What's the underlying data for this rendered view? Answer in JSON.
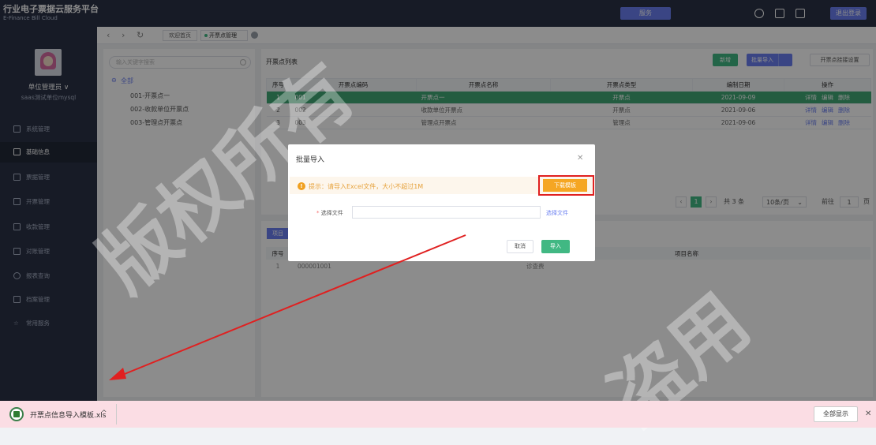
{
  "header": {
    "title": "行业电子票据云服务平台",
    "subtitle": "E-Finance Bill Cloud",
    "service_label": "服务",
    "logout_label": "退出登录"
  },
  "sidebar": {
    "role": "单位管理员 ∨",
    "org": "saas测试单位mysql",
    "items": [
      {
        "label": "系统管理"
      },
      {
        "label": "基础信息"
      },
      {
        "label": "票据管理"
      },
      {
        "label": "开票管理"
      },
      {
        "label": "收款管理"
      },
      {
        "label": "对账管理"
      },
      {
        "label": "报表查询"
      },
      {
        "label": "档案管理"
      },
      {
        "label": "常用服务"
      }
    ]
  },
  "tabs": {
    "back": "‹",
    "forward": "›",
    "refresh": "↻",
    "home": "欢迎首页",
    "current": "开票点管理"
  },
  "tree": {
    "search_placeholder": "输入关键字搜索",
    "root": "全部",
    "nodes": [
      "001-开票点一",
      "002-收款单位开票点",
      "003-管理点开票点"
    ]
  },
  "list": {
    "title": "开票点列表",
    "add_label": "新增",
    "batch_label": "批量导入",
    "settings_label": "开票点挂接设置",
    "columns": [
      "序号",
      "开票点编码",
      "开票点名称",
      "开票点类型",
      "编制日期",
      "操作"
    ],
    "rows": [
      {
        "no": "1",
        "code": "001",
        "name": "开票点一",
        "type": "开票点",
        "date": "2021-09-09"
      },
      {
        "no": "2",
        "code": "002",
        "name": "收款单位开票点",
        "type": "开票点",
        "date": "2021-09-06"
      },
      {
        "no": "3",
        "code": "003",
        "name": "管理点开票点",
        "type": "管理点",
        "date": "2021-09-06"
      }
    ],
    "actions": [
      "详情",
      "编辑",
      "删除"
    ]
  },
  "pagination": {
    "current_page": "1",
    "total": "共 3 条",
    "page_size": "10条/页",
    "goto_prefix": "前往",
    "goto_value": "1",
    "goto_suffix": "页"
  },
  "project": {
    "tab_label": "项目",
    "columns": [
      "序号",
      "项目名称"
    ],
    "rows": [
      {
        "no": "1",
        "code": "000001001",
        "name": "诊查费"
      }
    ]
  },
  "modal": {
    "title": "批量导入",
    "alert_icon": "!",
    "alert_text": "提示：请导入Excel文件，大小不超过1M",
    "download_label": "下载模板",
    "file_label_star": "*",
    "file_label": "选择文件",
    "file_select": "选择文件",
    "cancel_label": "取消",
    "import_label": "导入"
  },
  "download_bar": {
    "file_name": "开票点信息导入模板.xls",
    "chevron": "^",
    "show_all": "全部显示",
    "close": "✕"
  },
  "watermark": [
    "版权所有",
    "盗用"
  ],
  "colors": {
    "dark_nav": "#2b3246",
    "primary": "#6a7ff0",
    "success": "#41b883",
    "warning": "#f5a623",
    "highlight": "#e02020"
  }
}
